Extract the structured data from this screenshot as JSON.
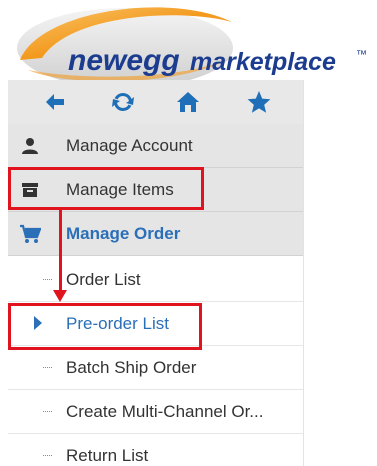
{
  "logo": {
    "brand": "newegg",
    "product": "marketplace",
    "trademark": "™"
  },
  "iconbar": {
    "icons": [
      "arrow-left-icon",
      "refresh-icon",
      "home-icon",
      "star-icon"
    ],
    "color": "#1f6fb8"
  },
  "menu": {
    "manage_account": "Manage Account",
    "manage_items": "Manage Items",
    "manage_order": "Manage Order"
  },
  "submenu": {
    "order_list": "Order List",
    "preorder_list": "Pre-order List",
    "batch_ship_order": "Batch Ship Order",
    "create_multichannel": "Create Multi-Channel Or...",
    "return_list": "Return List"
  },
  "colors": {
    "accent": "#2a6fb7",
    "annotation": "#e0141e",
    "brand_orange": "#f5a623"
  }
}
